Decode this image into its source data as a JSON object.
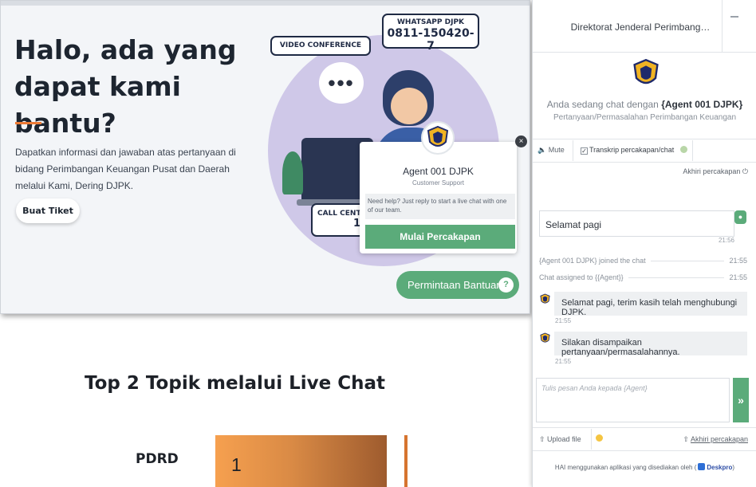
{
  "site": {
    "hero_title": "Halo, ada yang dapat kami bantu?",
    "hero_description": "Dapatkan informasi dan jawaban atas pertanyaan di bidang Perimbangan Keuangan Pusat dan Daerah melalui Kami, Dering DJPK.",
    "ticket_button": "Buat Tiket",
    "tag_video": "VIDEO CONFERENCE",
    "tag_whatsapp_title": "WHATSAPP DJPK",
    "tag_whatsapp_number": "0811-150420-7",
    "tag_callcenter_title": "CALL CENT",
    "tag_callcenter_number": "1",
    "popup": {
      "agent_name": "Agent 001 DJPK",
      "agent_role": "Customer Support",
      "help_text": "Need help? Just reply to start a live chat with one of our team.",
      "start_button": "Mulai Percakapan",
      "close_glyph": "×"
    },
    "help_button": "Permintaan Bantuan",
    "help_icon": "?",
    "dots": "•••"
  },
  "slide": {
    "heading": "Top 2 Topik melalui Live Chat",
    "bar_label": "PDRD",
    "bar_value": "1"
  },
  "chat": {
    "title": "Direktorat Jenderal Perimbang…",
    "chatting_with_prefix": "Anda sedang chat dengan",
    "agent_name": "{Agent 001 DJPK}",
    "topic": "Pertanyaan/Permasalahan Perimbangan Keuangan",
    "mute_label": "Mute",
    "transcript_label": "Transkrip percakapan/chat",
    "end_chat_top": "Akhiri percakapan",
    "messages": [
      {
        "type": "user",
        "text": "Selamat pagi",
        "time": "21:56"
      },
      {
        "type": "system",
        "text": "{Agent 001 DJPK} joined the chat",
        "time": "21:55"
      },
      {
        "type": "system",
        "text": "Chat assigned to {{Agent}}",
        "time": "21:55"
      },
      {
        "type": "agent",
        "text": "Selamat pagi, terim kasih telah menghubungi DJPK.",
        "time": "21:55"
      },
      {
        "type": "agent",
        "text": "Silakan disampaikan pertanyaan/permasalahannya.",
        "time": "21:55"
      }
    ],
    "compose_placeholder": "Tulis pesan Anda kepada {Agent}",
    "send_glyph": "»",
    "upload_label": "Upload file",
    "end_chat_bottom": "Akhiri percakapan",
    "footer_text": "HAI menggunakan aplikasi yang disediakan oleh",
    "footer_brand": "Deskpro",
    "footer_suffix": ")"
  },
  "colors": {
    "accent_green": "#5bab7a",
    "accent_orange": "#ec7a35",
    "brand_navy": "#1f2a44"
  }
}
